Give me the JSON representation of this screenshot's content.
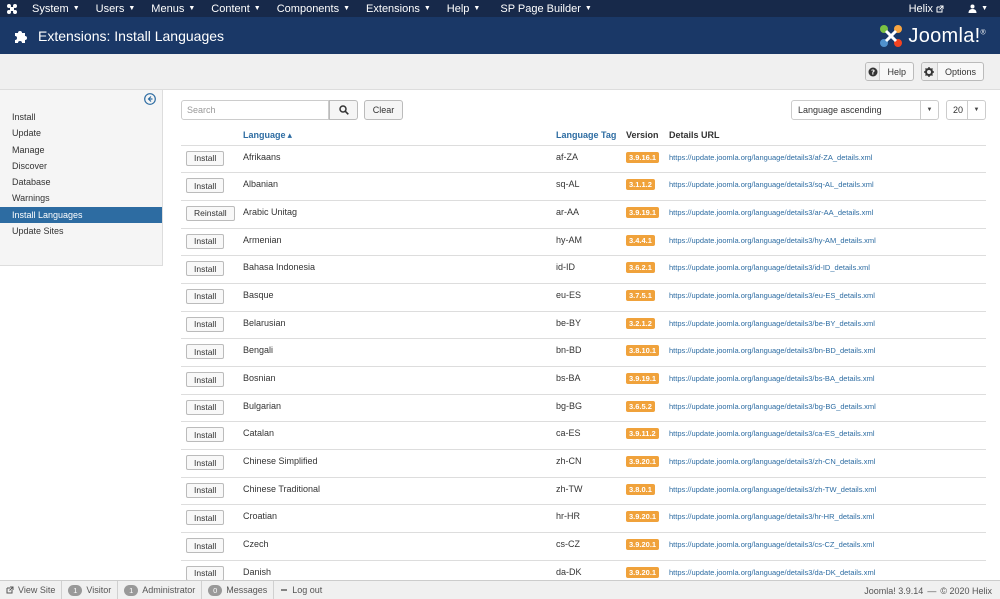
{
  "topnav": {
    "menus": [
      {
        "label": "System"
      },
      {
        "label": "Users"
      },
      {
        "label": "Menus"
      },
      {
        "label": "Content"
      },
      {
        "label": "Components"
      },
      {
        "label": "Extensions"
      },
      {
        "label": "Help"
      },
      {
        "label": "SP Page Builder"
      }
    ],
    "site_link": "Helix",
    "user_icon": "user-icon"
  },
  "header": {
    "title": "Extensions: Install Languages",
    "brand": "Joomla!",
    "brand_reg": "®",
    "icon": "puzzle-icon"
  },
  "toolbar": {
    "help_label": "Help",
    "options_label": "Options"
  },
  "sidebar": {
    "items": [
      {
        "label": "Install"
      },
      {
        "label": "Update"
      },
      {
        "label": "Manage"
      },
      {
        "label": "Discover"
      },
      {
        "label": "Database"
      },
      {
        "label": "Warnings"
      },
      {
        "label": "Install Languages",
        "active": true
      },
      {
        "label": "Update Sites"
      }
    ]
  },
  "search": {
    "placeholder": "Search",
    "value": "",
    "clear_label": "Clear",
    "sort_value": "Language ascending",
    "limit_value": "20"
  },
  "table": {
    "headers": {
      "language": "Language",
      "sort_indicator": "▴",
      "tag": "Language Tag",
      "version": "Version",
      "url": "Details URL"
    },
    "rows": [
      {
        "action": "Install",
        "language": "Afrikaans",
        "tag": "af-ZA",
        "version": "3.9.16.1",
        "url": "https://update.joomla.org/language/details3/af-ZA_details.xml"
      },
      {
        "action": "Install",
        "language": "Albanian",
        "tag": "sq-AL",
        "version": "3.1.1.2",
        "url": "https://update.joomla.org/language/details3/sq-AL_details.xml"
      },
      {
        "action": "Reinstall",
        "language": "Arabic Unitag",
        "tag": "ar-AA",
        "version": "3.9.19.1",
        "url": "https://update.joomla.org/language/details3/ar-AA_details.xml"
      },
      {
        "action": "Install",
        "language": "Armenian",
        "tag": "hy-AM",
        "version": "3.4.4.1",
        "url": "https://update.joomla.org/language/details3/hy-AM_details.xml"
      },
      {
        "action": "Install",
        "language": "Bahasa Indonesia",
        "tag": "id-ID",
        "version": "3.6.2.1",
        "url": "https://update.joomla.org/language/details3/id-ID_details.xml"
      },
      {
        "action": "Install",
        "language": "Basque",
        "tag": "eu-ES",
        "version": "3.7.5.1",
        "url": "https://update.joomla.org/language/details3/eu-ES_details.xml"
      },
      {
        "action": "Install",
        "language": "Belarusian",
        "tag": "be-BY",
        "version": "3.2.1.2",
        "url": "https://update.joomla.org/language/details3/be-BY_details.xml"
      },
      {
        "action": "Install",
        "language": "Bengali",
        "tag": "bn-BD",
        "version": "3.8.10.1",
        "url": "https://update.joomla.org/language/details3/bn-BD_details.xml"
      },
      {
        "action": "Install",
        "language": "Bosnian",
        "tag": "bs-BA",
        "version": "3.9.19.1",
        "url": "https://update.joomla.org/language/details3/bs-BA_details.xml"
      },
      {
        "action": "Install",
        "language": "Bulgarian",
        "tag": "bg-BG",
        "version": "3.6.5.2",
        "url": "https://update.joomla.org/language/details3/bg-BG_details.xml"
      },
      {
        "action": "Install",
        "language": "Catalan",
        "tag": "ca-ES",
        "version": "3.9.11.2",
        "url": "https://update.joomla.org/language/details3/ca-ES_details.xml"
      },
      {
        "action": "Install",
        "language": "Chinese Simplified",
        "tag": "zh-CN",
        "version": "3.9.20.1",
        "url": "https://update.joomla.org/language/details3/zh-CN_details.xml"
      },
      {
        "action": "Install",
        "language": "Chinese Traditional",
        "tag": "zh-TW",
        "version": "3.8.0.1",
        "url": "https://update.joomla.org/language/details3/zh-TW_details.xml"
      },
      {
        "action": "Install",
        "language": "Croatian",
        "tag": "hr-HR",
        "version": "3.9.20.1",
        "url": "https://update.joomla.org/language/details3/hr-HR_details.xml"
      },
      {
        "action": "Install",
        "language": "Czech",
        "tag": "cs-CZ",
        "version": "3.9.20.1",
        "url": "https://update.joomla.org/language/details3/cs-CZ_details.xml"
      },
      {
        "action": "Install",
        "language": "Danish",
        "tag": "da-DK",
        "version": "3.9.20.1",
        "url": "https://update.joomla.org/language/details3/da-DK_details.xml"
      }
    ]
  },
  "footer": {
    "view_site": "View Site",
    "visitor_count": "1",
    "visitor_label": "Visitor",
    "admin_count": "1",
    "admin_label": "Administrator",
    "messages_count": "0",
    "messages_label": "Messages",
    "logout": "Log out",
    "version_text": "Joomla! 3.9.14",
    "separator": "—",
    "copyright": "© 2020 Helix"
  },
  "colors": {
    "topnav_bg": "#17294a",
    "header_bg": "#1a3867",
    "active_sidebar": "#2d6ca2",
    "link": "#2d6ca2",
    "version_badge": "#f0a23b"
  }
}
